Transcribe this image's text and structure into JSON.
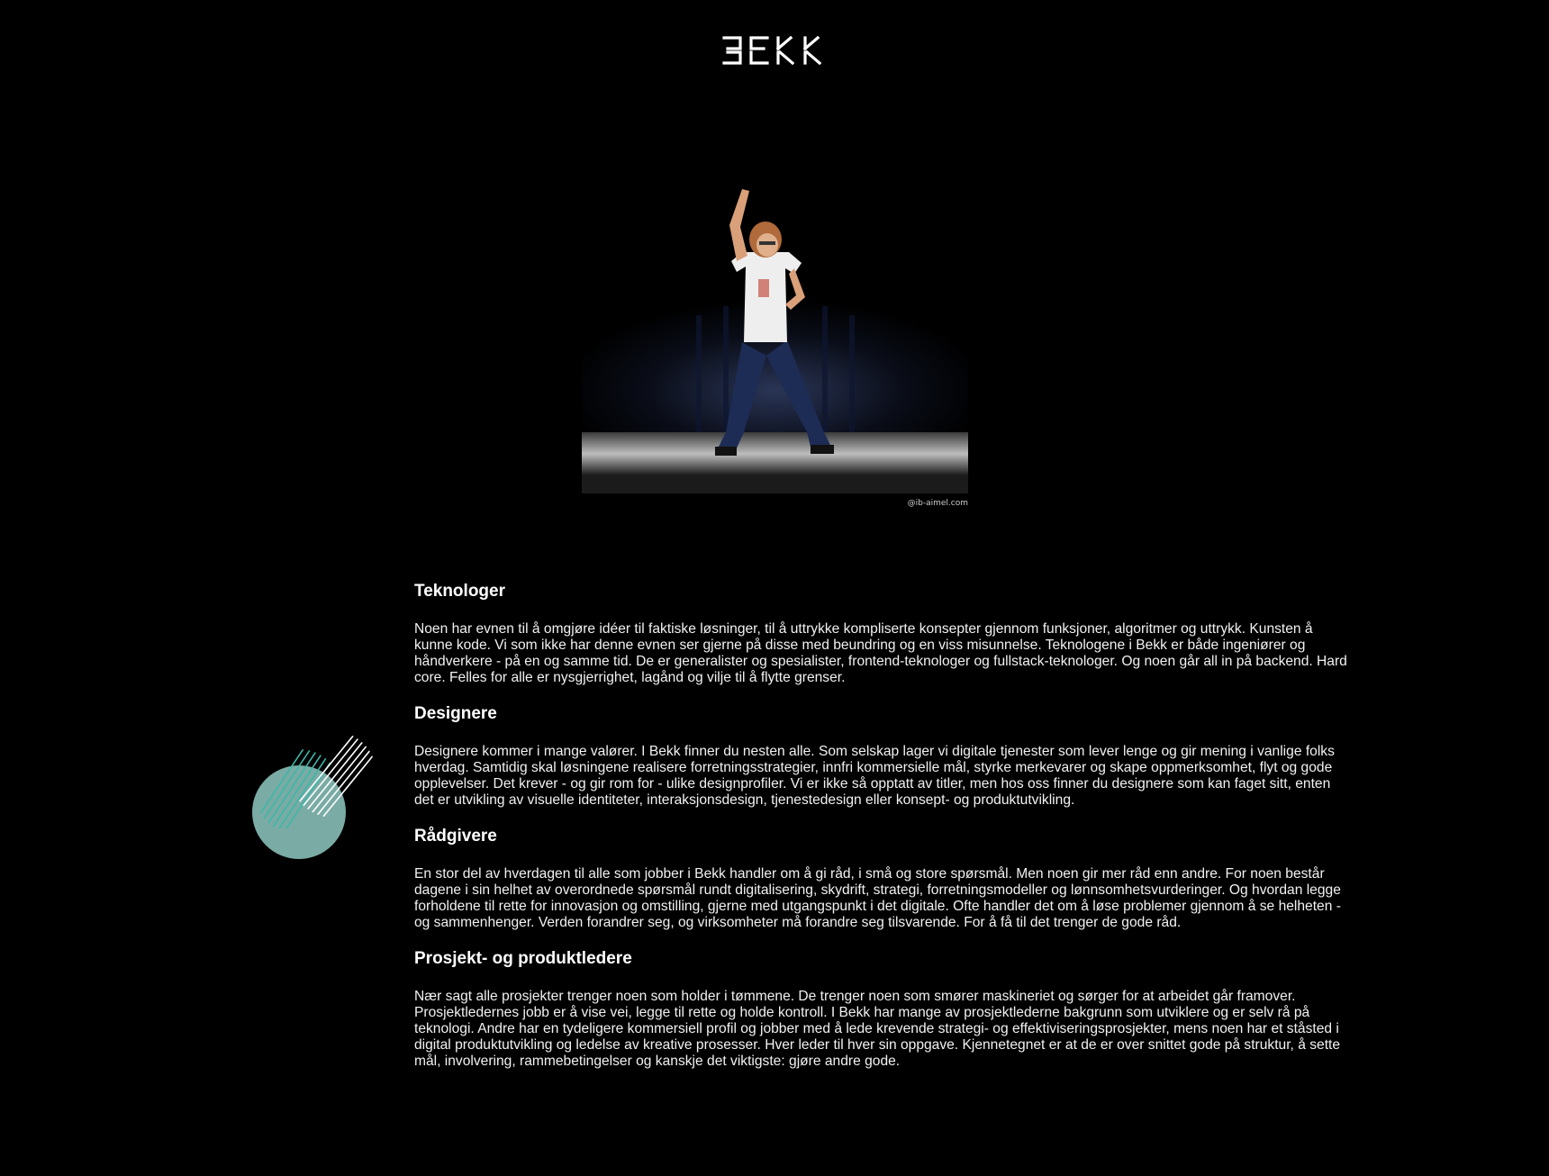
{
  "brand": {
    "logo_text": "BEKK"
  },
  "hero": {
    "alt": "Dancing performer on a stage",
    "watermark": "@ib-aimel.com"
  },
  "sections": [
    {
      "title": "Teknologer",
      "body": "Noen har evnen til å omgjøre idéer til faktiske løsninger, til å uttrykke kompliserte konsepter gjennom funksjoner, algoritmer og uttrykk. Kunsten å kunne kode. Vi som ikke har denne evnen ser gjerne på disse med beundring og en viss misunnelse. Teknologene i Bekk er både ingeniører og håndverkere - på en og samme tid. De er generalister og spesialister, frontend-teknologer og fullstack-teknologer. Og noen går all in på backend. Hard core. Felles for alle er nysgjerrighet, lagånd og vilje til å flytte grenser."
    },
    {
      "title": "Designere",
      "body": "Designere kommer i mange valører. I Bekk finner du nesten alle. Som selskap lager vi digitale tjenester som lever lenge og gir mening i vanlige folks hverdag. Samtidig skal løsningene realisere forretningsstrategier, innfri kommersielle mål, styrke merkevarer og skape oppmerksomhet, flyt og gode opplevelser. Det krever - og gir rom for - ulike designprofiler. Vi er ikke så opptatt av titler, men hos oss finner du designere som kan faget sitt, enten det er utvikling av visuelle identiteter, interaksjonsdesign, tjenestedesign eller konsept- og produktutvikling."
    },
    {
      "title": "Rådgivere",
      "body": "En stor del av hverdagen til alle som jobber i Bekk handler om å gi råd, i små og store spørsmål. Men noen gir mer råd enn andre. For noen består dagene i sin helhet av overordnede spørsmål rundt digitalisering, skydrift, strategi, forretningsmodeller og lønnsomhetsvurderinger. Og hvordan legge forholdene til rette for innovasjon og omstilling, gjerne med utgangspunkt i det digitale. Ofte handler det om å løse problemer gjennom å se helheten - og sammenhenger. Verden forandrer seg, og virksomheter må forandre seg tilsvarende. For å få til det trenger de gode råd."
    },
    {
      "title": "Prosjekt- og produktledere",
      "body": "Nær sagt alle prosjekter trenger noen som holder i tømmene. De trenger noen som smører maskineriet og sørger for at arbeidet går framover. Prosjektledernes jobb er å vise vei, legge til rette og holde kontroll. I Bekk har mange av prosjektlederne bakgrunn som utviklere og er selv rå på teknologi. Andre har en tydeligere kommersiell profil og jobber med å lede krevende strategi- og effektiviseringsprosjekter, mens noen har et ståsted i digital produktutvikling og ledelse av kreative prosesser. Hver leder til hver sin oppgave. Kjennetegnet er at de er over snittet gode på struktur, å sette mål, involvering, rammebetingelser og kanskje det viktigste: gjøre andre gode."
    }
  ],
  "colors": {
    "background": "#000000",
    "text": "#ffffff",
    "accent_teal": "#8fc9c2"
  }
}
